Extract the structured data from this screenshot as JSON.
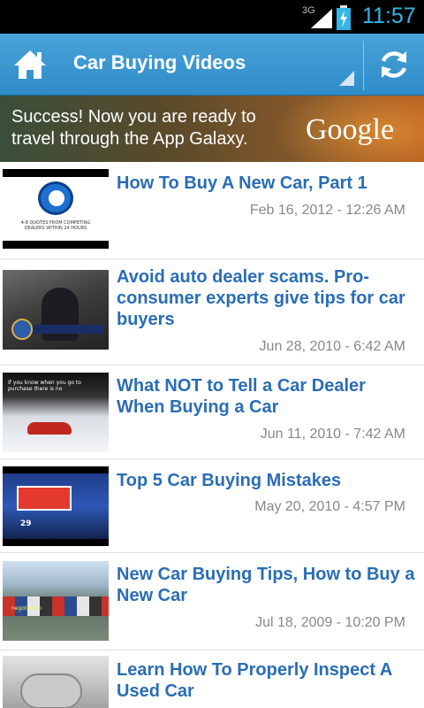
{
  "status_bar": {
    "network": "3G",
    "time": "11:57"
  },
  "action_bar": {
    "title": "Car Buying Videos"
  },
  "ad": {
    "text": "Success! Now you are ready to travel through the App Galaxy.",
    "brand": "Google"
  },
  "videos": [
    {
      "title": "How To Buy A New Car, Part 1",
      "date": "Feb 16, 2012 - 12:26 AM",
      "thumb_caption": "4-8 QUOTES FROM COMPETING DEALERS WITHIN 24 HOURS"
    },
    {
      "title": "Avoid auto dealer scams. Pro-consumer experts give tips for car buyers",
      "date": "Jun 28, 2010 - 6:42 AM"
    },
    {
      "title": "What NOT to Tell a Car Dealer When Buying a Car",
      "date": "Jun 11, 2010 - 7:42 AM",
      "thumb_caption": "If you know when you go to purchase there is no"
    },
    {
      "title": "Top 5 Car Buying Mistakes",
      "date": "May 20, 2010 - 4:57 PM",
      "thumb_caption": "Negotiating a car at the dealership",
      "thumb_badge": "29"
    },
    {
      "title": "New Car Buying Tips, How to Buy a New Car",
      "date": "Jul 18, 2009 - 10:20 PM",
      "thumb_caption": "negotiation"
    },
    {
      "title": "Learn How To Properly Inspect A Used Car",
      "date": ""
    }
  ],
  "colors": {
    "action_bar": "#2f8cc9",
    "title_link": "#2a6db5",
    "clock": "#33b5e5"
  },
  "icons": {
    "home": "home-icon",
    "refresh": "refresh-icon",
    "battery": "battery-charging-icon",
    "signal": "signal-icon"
  }
}
